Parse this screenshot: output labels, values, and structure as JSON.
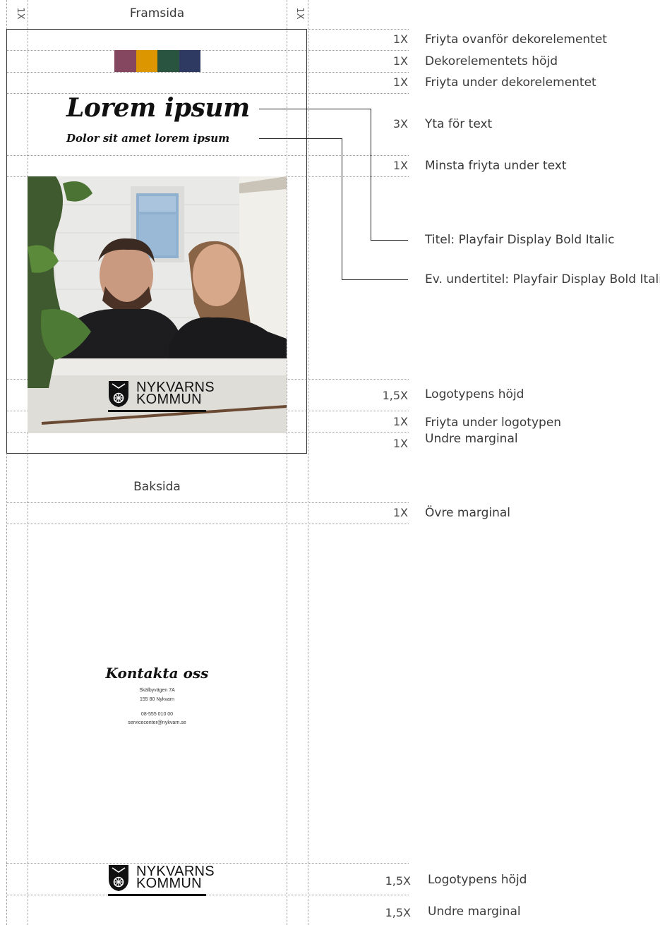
{
  "margin_marks": {
    "left": "1X",
    "right": "1X"
  },
  "front": {
    "heading": "Framsida",
    "deco_colors": [
      "#84475f",
      "#dc9700",
      "#295540",
      "#2f3a63"
    ],
    "title": "Lorem ipsum",
    "subtitle": "Dolor sit amet lorem ipsum",
    "photo_icon": "photo-two-people",
    "logo": {
      "line1": "NYKVARNS",
      "line2": "KOMMUN"
    }
  },
  "front_guides": [
    {
      "unit": "1X",
      "label": "Friyta ovanför dekorelementet"
    },
    {
      "unit": "1X",
      "label": "Dekorelementets höjd"
    },
    {
      "unit": "1X",
      "label": "Friyta under dekorelementet"
    },
    {
      "unit": "3X",
      "label": "Yta för text"
    },
    {
      "unit": "1X",
      "label": "Minsta friyta under text"
    },
    {
      "unit": "1,5X",
      "label": "Logotypens höjd"
    },
    {
      "unit": "1X",
      "label": "Friyta under logotypen"
    },
    {
      "unit": "1X",
      "label": "Undre marginal"
    }
  ],
  "typography_notes": {
    "title": "Titel: Playfair Display Bold Italic",
    "subtitle": "Ev. undertitel: Playfair Display Bold Italic"
  },
  "back": {
    "heading": "Baksida",
    "contact_title": "Kontakta oss",
    "address1": "Skälbyvägen 7A",
    "address2": "155 80 Nykvarn",
    "phone": "08-555 010 00",
    "email": "servicecenter@nykvarn.se",
    "logo": {
      "line1": "NYKVARNS",
      "line2": "KOMMUN"
    }
  },
  "back_guides": [
    {
      "unit": "1X",
      "label": "Övre marginal"
    },
    {
      "unit": "1,5X",
      "label": "Logotypens höjd"
    },
    {
      "unit": "1,5X",
      "label": "Undre marginal"
    }
  ]
}
